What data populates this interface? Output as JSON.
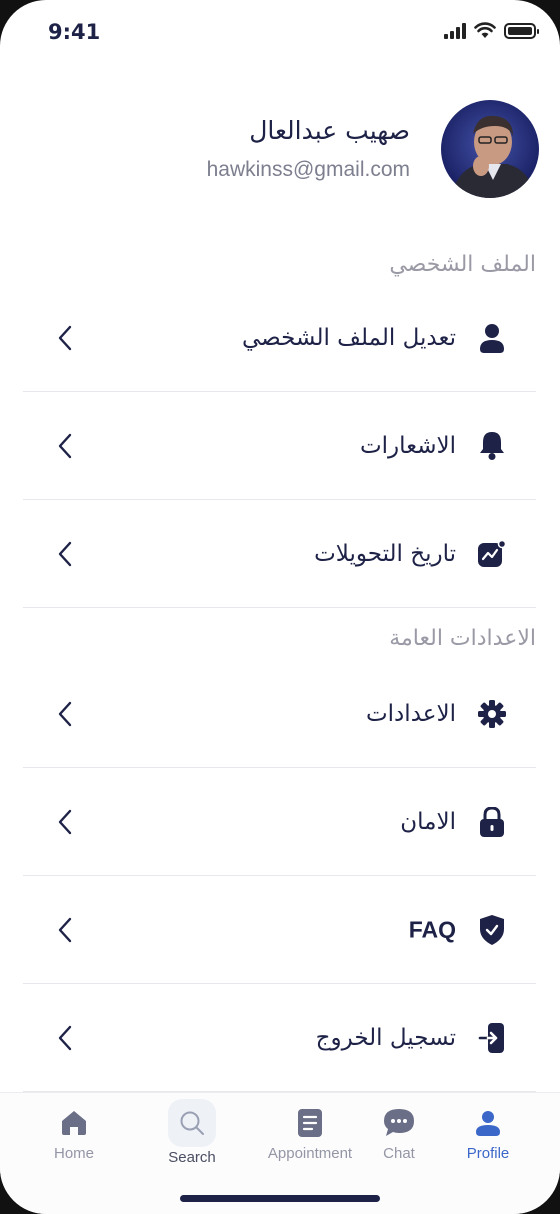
{
  "status_bar": {
    "time": "9:41"
  },
  "profile": {
    "name": "صهيب عبدالعال",
    "email": "hawkinss@gmail.com"
  },
  "sections": {
    "personal": "الملف الشخصي",
    "general": "الاعدادات العامة"
  },
  "menu": {
    "edit_profile": "تعديل الملف الشخصي",
    "notifications": "الاشعارات",
    "transactions": "تاريخ التحويلات",
    "settings": "الاعدادات",
    "security": "الامان",
    "faq": "FAQ",
    "logout": "تسجيل الخروج"
  },
  "tabs": [
    {
      "label": "Home",
      "icon": "home-icon"
    },
    {
      "label": "Search",
      "icon": "search-icon"
    },
    {
      "label": "Appointment",
      "icon": "document-icon"
    },
    {
      "label": "Chat",
      "icon": "chat-icon"
    },
    {
      "label": "Profile",
      "icon": "profile-icon",
      "active": true
    }
  ],
  "colors": {
    "primary": "#1e2247",
    "accent": "#3b67c8",
    "muted": "#9a9aa6"
  }
}
